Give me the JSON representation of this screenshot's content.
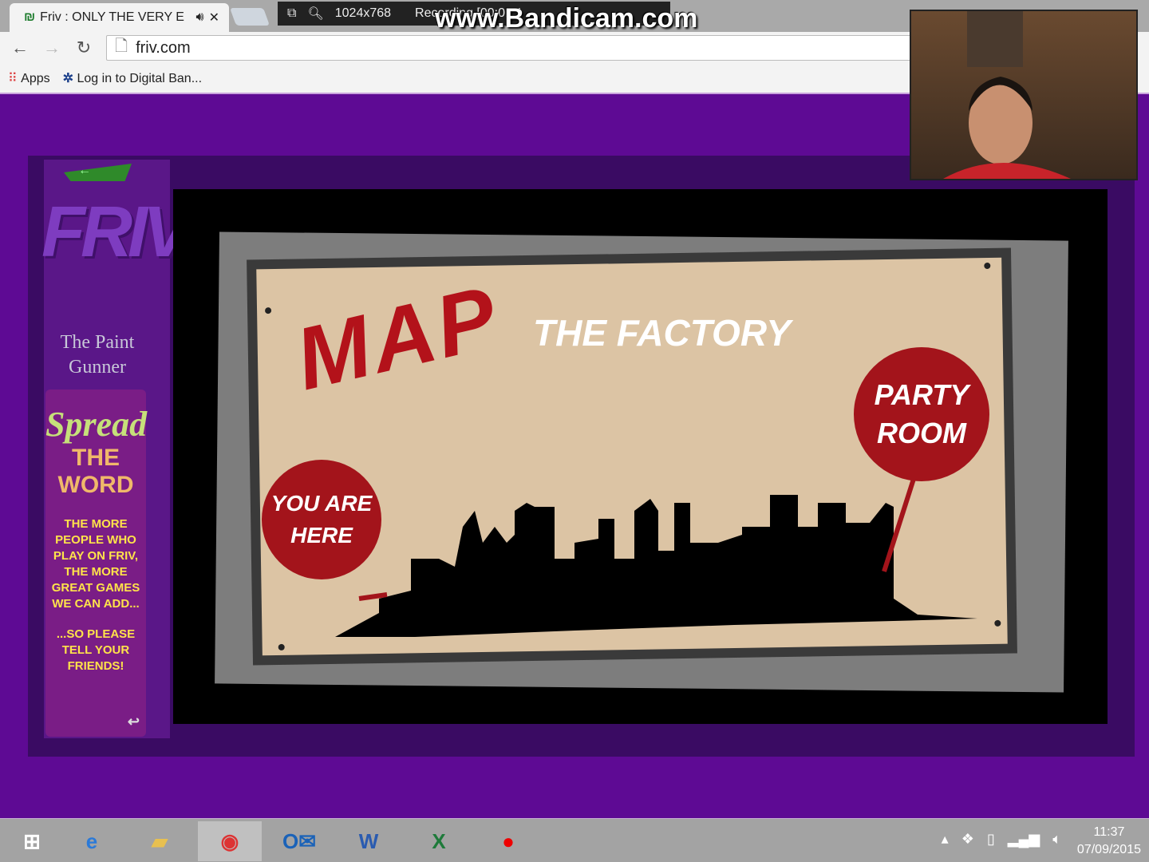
{
  "browser": {
    "tab_title": "Friv : ONLY THE VERY E",
    "url": "friv.com",
    "bookmarks": [
      {
        "label": "Apps"
      },
      {
        "label": "Log in to Digital Ban..."
      }
    ]
  },
  "recorder": {
    "resolution": "1024x768",
    "status": "Recording [00:01:1",
    "watermark": "www.Bandicam.com"
  },
  "sidebar": {
    "logo": "FRIV",
    "game_title_1": "The Paint",
    "game_title_2": "Gunner",
    "spread": "Spread",
    "the_word": "THE WORD",
    "message": "THE MORE PEOPLE WHO PLAY ON FRIV, THE MORE GREAT GAMES WE CAN ADD...",
    "message2": "...SO PLEASE TELL YOUR FRIENDS!"
  },
  "game": {
    "map_title": "MAP",
    "location": "THE FACTORY",
    "you_are_here": "YOU ARE HERE",
    "party_room": "PARTY ROOM"
  },
  "taskbar": {
    "time": "11:37",
    "date": "07/09/2015"
  }
}
